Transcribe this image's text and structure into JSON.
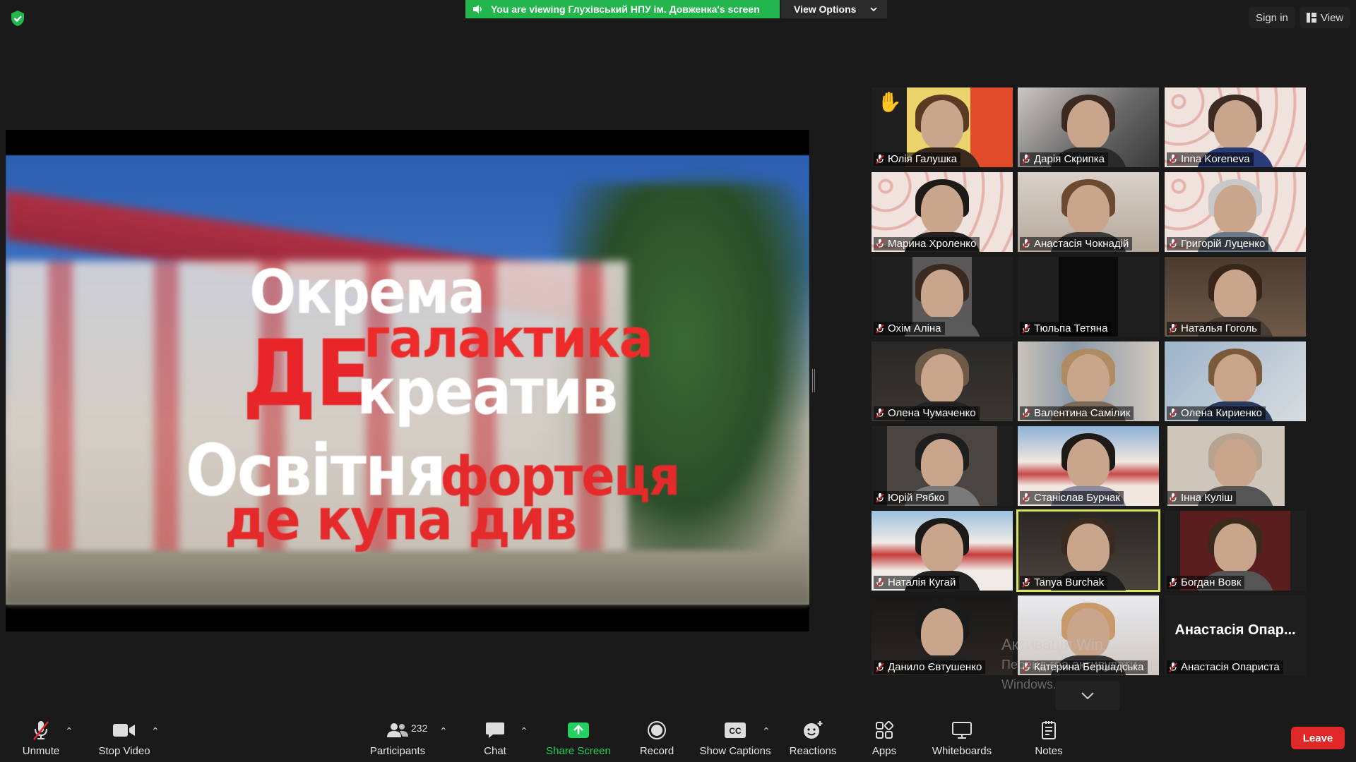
{
  "banner": {
    "viewing_text": "You are viewing Глухівський НПУ ім. Довженка's screen",
    "view_options": "View Options"
  },
  "header": {
    "sign_in": "Sign in",
    "view": "View"
  },
  "shared_screen": {
    "lines": [
      "Окрема",
      "галактика",
      "ДЕ",
      "креатив",
      "Освітня",
      "фортеця",
      "де купа див"
    ]
  },
  "participants": [
    {
      "name": "Юлія Галушка",
      "hand_raised": true
    },
    {
      "name": "Дарія Скрипка"
    },
    {
      "name": "Inna Koreneva"
    },
    {
      "name": "Марина Хроленко"
    },
    {
      "name": "Анастасія Чокнадій"
    },
    {
      "name": "Григорій Луценко"
    },
    {
      "name": "Охім Аліна"
    },
    {
      "name": "Тюльпа Тетяна"
    },
    {
      "name": "Наталья Гоголь"
    },
    {
      "name": "Олена Чумаченко"
    },
    {
      "name": "Валентина Самілик"
    },
    {
      "name": "Олена Кириенко"
    },
    {
      "name": "Юрій Рябко"
    },
    {
      "name": "Станіслав Бурчак"
    },
    {
      "name": "Інна Куліш"
    },
    {
      "name": "Наталія Кугай"
    },
    {
      "name": "Tanya Burchak",
      "active": true
    },
    {
      "name": "Богдан Вовк"
    },
    {
      "name": "Данило Євтушенко"
    },
    {
      "name": "Катерина Бершадська"
    },
    {
      "name": "Анастасія Опариста",
      "display_name": "Анастасія Опар..."
    }
  ],
  "watermark": {
    "line1": "Активація Win",
    "line2": "Перейд                               гра   активувати",
    "line3": "Windows."
  },
  "toolbar": {
    "unmute": "Unmute",
    "stop_video": "Stop Video",
    "participants": "Participants",
    "participants_count": "232",
    "chat": "Chat",
    "share_screen": "Share Screen",
    "record": "Record",
    "show_captions": "Show Captions",
    "reactions": "Reactions",
    "apps": "Apps",
    "whiteboards": "Whiteboards",
    "notes": "Notes",
    "leave": "Leave"
  },
  "colors": {
    "banner_green": "#23b64d",
    "share_green": "#23d160",
    "leave_red": "#e02828",
    "active_speaker": "#d8e55a"
  }
}
